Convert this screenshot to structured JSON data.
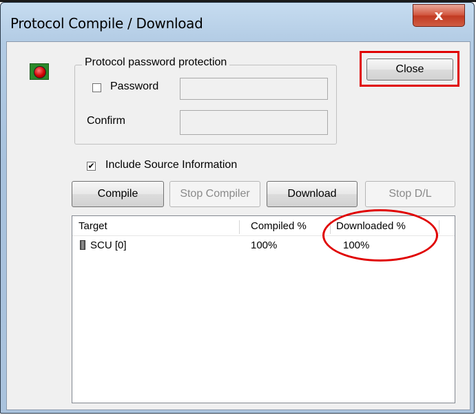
{
  "window": {
    "title": "Protocol Compile / Download",
    "close_glyph": "x"
  },
  "protection": {
    "legend": "Protocol password protection",
    "password_label": "Password",
    "password_checked": false,
    "password_value": "",
    "confirm_label": "Confirm",
    "confirm_value": ""
  },
  "include_source": {
    "label": "Include Source Information",
    "checked": true,
    "glyph": "✔"
  },
  "buttons": {
    "close": "Close",
    "compile": "Compile",
    "stop_compiler": "Stop Compiler",
    "download": "Download",
    "stop_dl": "Stop D/L"
  },
  "table": {
    "columns": [
      "Target",
      "Compiled %",
      "Downloaded %"
    ],
    "rows": [
      {
        "target": "SCU [0]",
        "compiled": "100%",
        "downloaded": "100%",
        "icon": "device-icon"
      }
    ]
  },
  "annotations": {
    "color": "#e00000"
  }
}
